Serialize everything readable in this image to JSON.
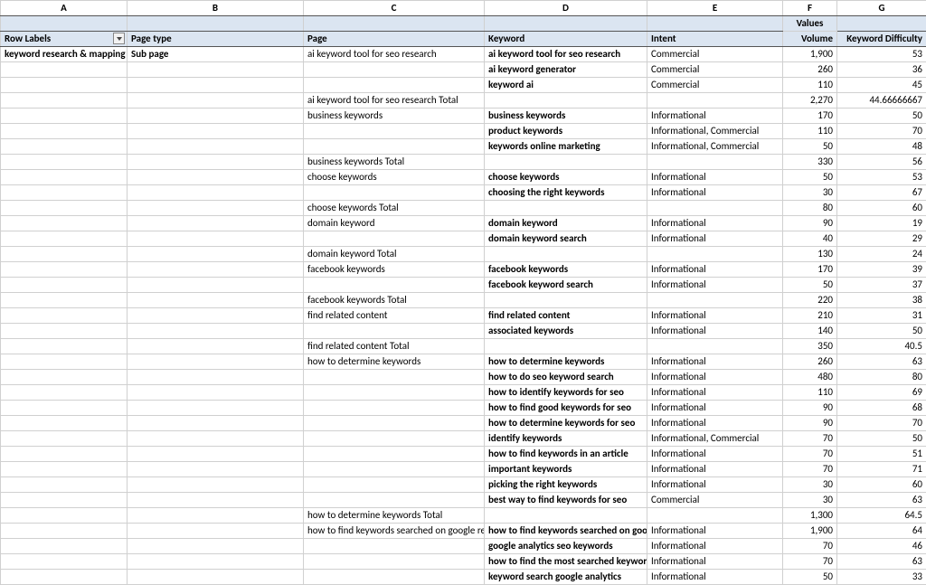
{
  "column_letters": [
    "A",
    "B",
    "C",
    "D",
    "E",
    "F",
    "G"
  ],
  "values_label": "Values",
  "headers": {
    "row_labels": "Row Labels",
    "page_type": "Page type",
    "page": "Page",
    "keyword": "Keyword",
    "intent": "Intent",
    "volume": "Volume",
    "kd": "Keyword Difficulty"
  },
  "rows": [
    {
      "a": "keyword research & mapping",
      "b": "Sub page",
      "c": "ai keyword tool for seo research",
      "d": "ai keyword tool for seo research",
      "e": "Commercial",
      "f": "1,900",
      "g": "53",
      "a_b": true,
      "b_b": true,
      "d_b": true
    },
    {
      "d": "ai keyword generator",
      "e": "Commercial",
      "f": "260",
      "g": "36",
      "d_b": true
    },
    {
      "d": "keyword ai",
      "e": "Commercial",
      "f": "110",
      "g": "45",
      "d_b": true
    },
    {
      "c": "ai keyword tool for seo research Total",
      "f": "2,270",
      "g": "44.66666667"
    },
    {
      "c": "business keywords",
      "d": "business keywords",
      "e": "Informational",
      "f": "170",
      "g": "50",
      "d_b": true
    },
    {
      "d": "product keywords",
      "e": "Informational, Commercial",
      "f": "110",
      "g": "70",
      "d_b": true
    },
    {
      "d": "keywords online marketing",
      "e": "Informational, Commercial",
      "f": "50",
      "g": "48",
      "d_b": true
    },
    {
      "c": "business keywords Total",
      "f": "330",
      "g": "56"
    },
    {
      "c": "choose keywords",
      "d": "choose keywords",
      "e": "Informational",
      "f": "50",
      "g": "53",
      "d_b": true
    },
    {
      "d": "choosing the right keywords",
      "e": "Informational",
      "f": "30",
      "g": "67",
      "d_b": true
    },
    {
      "c": "choose keywords Total",
      "f": "80",
      "g": "60"
    },
    {
      "c": "domain keyword",
      "d": "domain keyword",
      "e": "Informational",
      "f": "90",
      "g": "19",
      "d_b": true
    },
    {
      "d": "domain keyword search",
      "e": "Informational",
      "f": "40",
      "g": "29",
      "d_b": true
    },
    {
      "c": "domain keyword Total",
      "f": "130",
      "g": "24"
    },
    {
      "c": "facebook keywords",
      "d": "facebook keywords",
      "e": "Informational",
      "f": "170",
      "g": "39",
      "d_b": true
    },
    {
      "d": "facebook keyword search",
      "e": "Informational",
      "f": "50",
      "g": "37",
      "d_b": true
    },
    {
      "c": "facebook keywords Total",
      "f": "220",
      "g": "38"
    },
    {
      "c": "find related content",
      "d": "find related content",
      "e": "Informational",
      "f": "210",
      "g": "31",
      "d_b": true
    },
    {
      "d": "associated keywords",
      "e": "Informational",
      "f": "140",
      "g": "50",
      "d_b": true
    },
    {
      "c": "find related content Total",
      "f": "350",
      "g": "40.5"
    },
    {
      "c": "how to determine keywords",
      "d": "how to determine keywords",
      "e": "Informational",
      "f": "260",
      "g": "63",
      "d_b": true
    },
    {
      "d": "how to do seo keyword search",
      "e": "Informational",
      "f": "480",
      "g": "80",
      "d_b": true
    },
    {
      "d": "how to identify keywords for seo",
      "e": "Informational",
      "f": "110",
      "g": "69",
      "d_b": true
    },
    {
      "d": "how to find good keywords for seo",
      "e": "Informational",
      "f": "90",
      "g": "68",
      "d_b": true
    },
    {
      "d": "how to determine keywords for seo",
      "e": "Informational",
      "f": "90",
      "g": "70",
      "d_b": true
    },
    {
      "d": "identify keywords",
      "e": "Informational, Commercial",
      "f": "70",
      "g": "50",
      "d_b": true
    },
    {
      "d": "how to find keywords in an article",
      "e": "Informational",
      "f": "70",
      "g": "51",
      "d_b": true
    },
    {
      "d": "important keywords",
      "e": "Informational",
      "f": "70",
      "g": "71",
      "d_b": true
    },
    {
      "d": "picking the right keywords",
      "e": "Informational",
      "f": "30",
      "g": "60",
      "d_b": true
    },
    {
      "d": "best way to find keywords for seo",
      "e": "Commercial",
      "f": "30",
      "g": "63",
      "d_b": true
    },
    {
      "c": "how to determine keywords Total",
      "f": "1,300",
      "g": "64.5"
    },
    {
      "c": "how to find keywords searched on google results",
      "d": "how to find keywords searched on google re",
      "e": "Informational",
      "f": "1,900",
      "g": "64",
      "d_b": true
    },
    {
      "d": "google analytics seo keywords",
      "e": "Informational",
      "f": "70",
      "g": "46",
      "d_b": true
    },
    {
      "d": "how to find the most searched keywords",
      "e": "Informational",
      "f": "70",
      "g": "63",
      "d_b": true
    },
    {
      "d": "keyword search google analytics",
      "e": "Informational",
      "f": "50",
      "g": "33",
      "d_b": true
    }
  ]
}
